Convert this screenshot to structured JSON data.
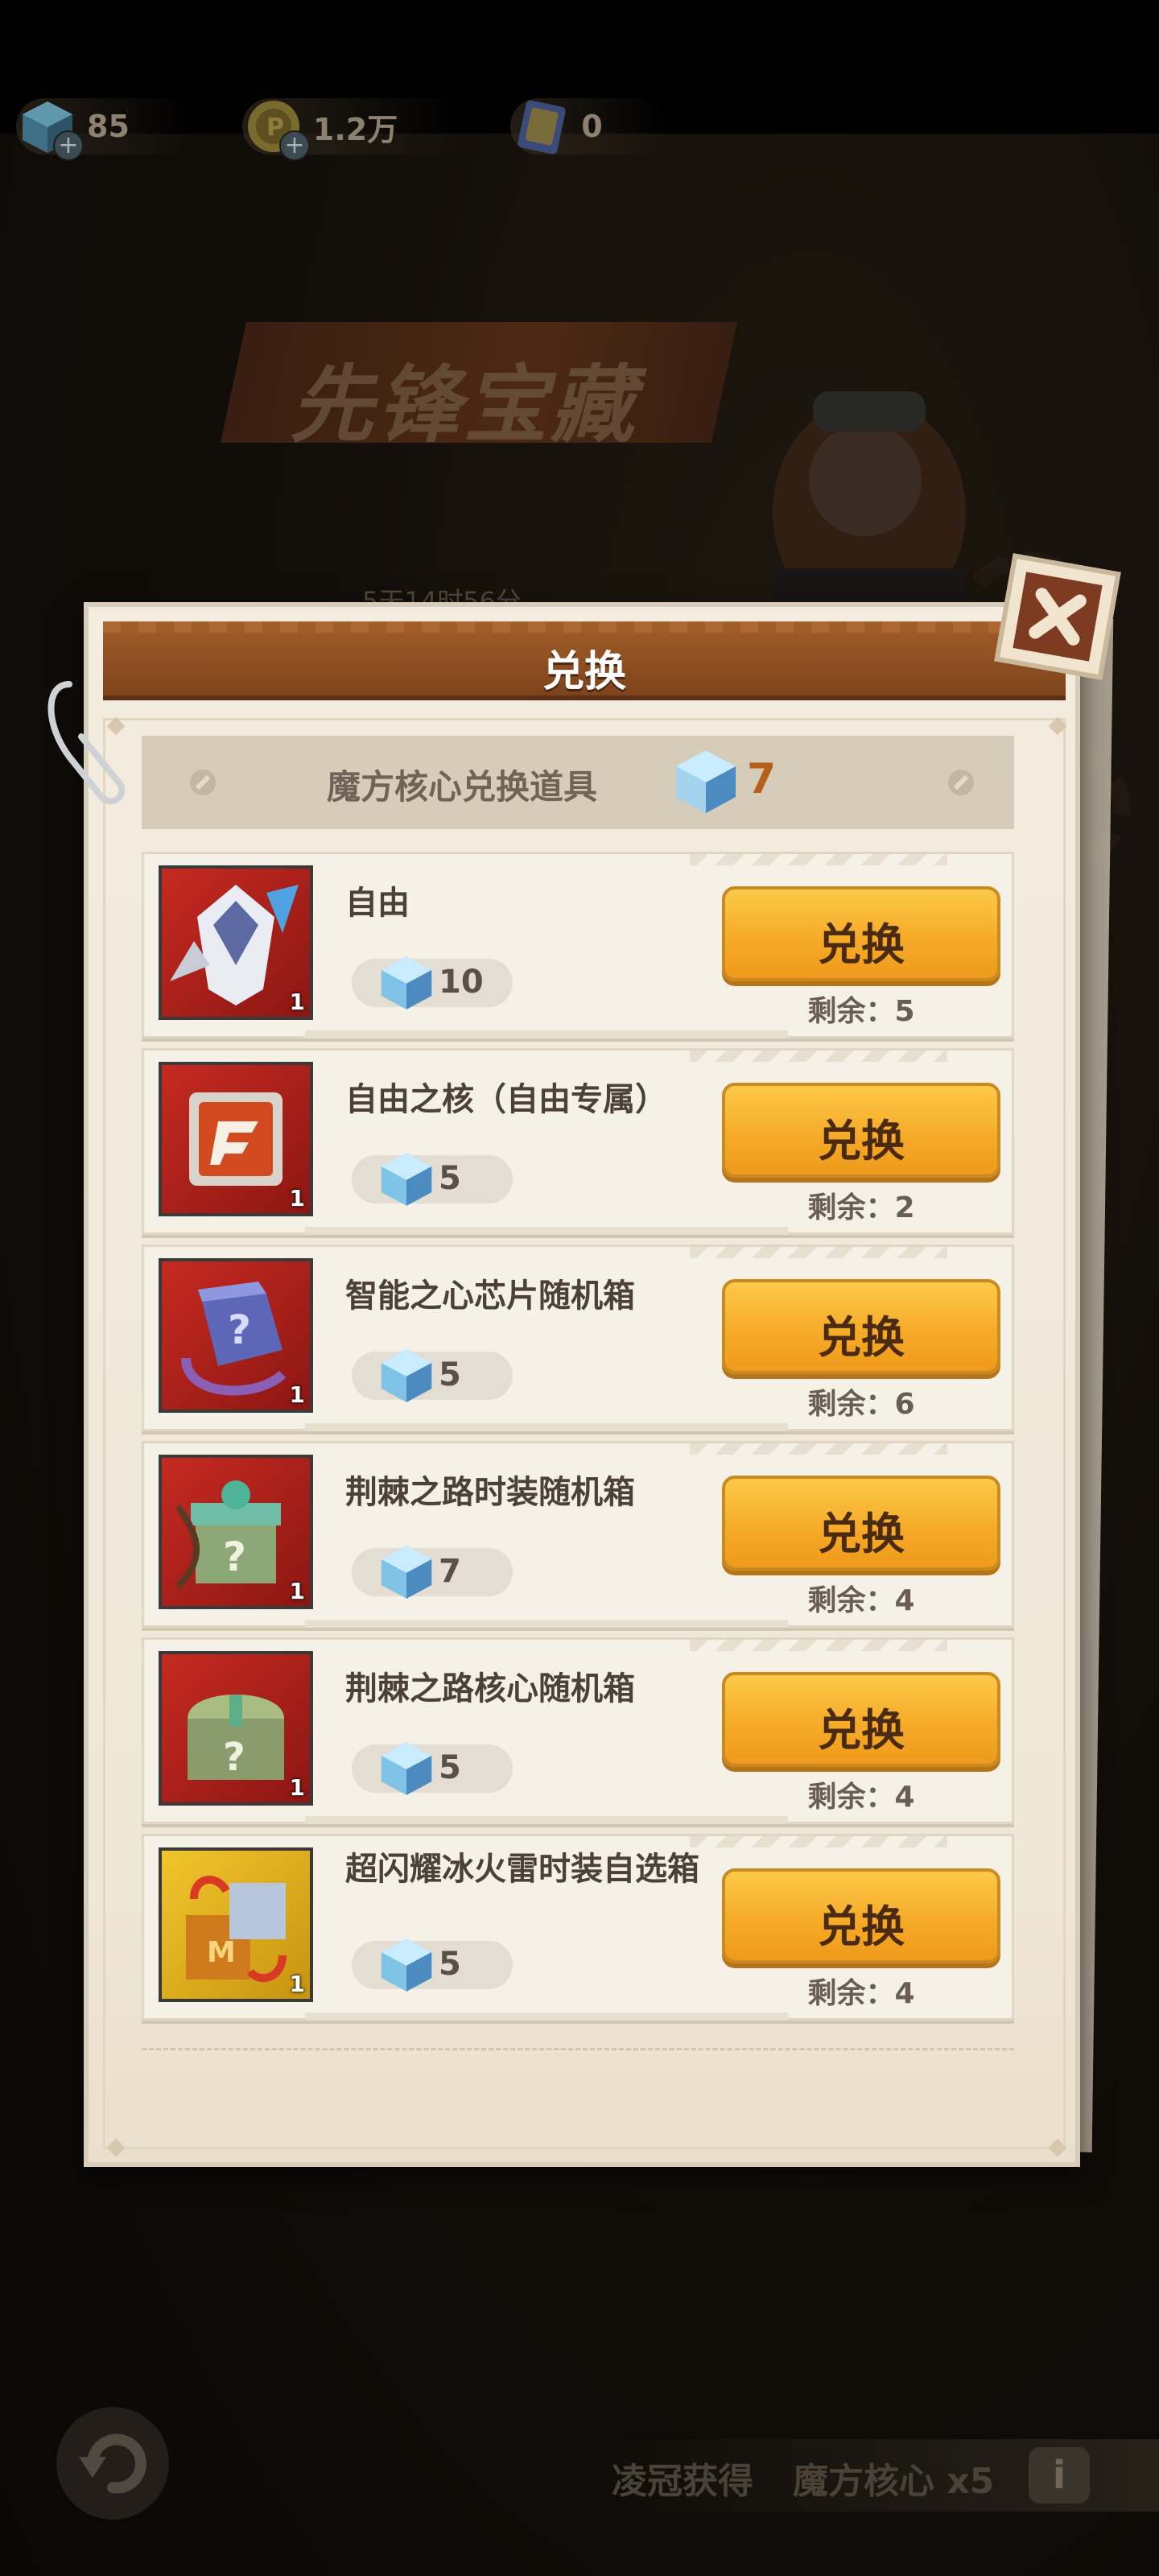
{
  "currencies": [
    {
      "icon": "cube-gem-icon",
      "value": "85"
    },
    {
      "icon": "coin-icon",
      "value": "1.2万"
    },
    {
      "icon": "card-icon",
      "value": "0"
    }
  ],
  "banner": {
    "title": "先锋宝藏",
    "subtitle": "5天14时56分"
  },
  "dialog": {
    "title": "兑换",
    "subheader": {
      "label": "魔方核心兑换道具",
      "count": "7"
    },
    "exchange_label": "兑换",
    "remain_label": "剩余：",
    "items": [
      {
        "name": "自由",
        "cost": "10",
        "remaining": "5",
        "qty": "1",
        "icon": "mecha-icon"
      },
      {
        "name": "自由之核（自由专属）",
        "cost": "5",
        "remaining": "2",
        "qty": "1",
        "icon": "core-icon"
      },
      {
        "name": "智能之心芯片随机箱",
        "cost": "5",
        "remaining": "6",
        "qty": "1",
        "icon": "chip-box-icon"
      },
      {
        "name": "荆棘之路时装随机箱",
        "cost": "7",
        "remaining": "4",
        "qty": "1",
        "icon": "gift-box-icon"
      },
      {
        "name": "荆棘之路核心随机箱",
        "cost": "5",
        "remaining": "4",
        "qty": "1",
        "icon": "treasure-chest-icon"
      },
      {
        "name": "超闪耀冰火雷时装自选箱",
        "cost": "5",
        "remaining": "4",
        "qty": "1",
        "icon": "selection-box-icon"
      }
    ]
  },
  "bottom": {
    "label": "凌冠获得",
    "reward": "魔方核心 x5",
    "info": "i"
  },
  "colors": {
    "button": "#f5a926",
    "header": "#8e4f22",
    "accent_count": "#b5601c"
  }
}
